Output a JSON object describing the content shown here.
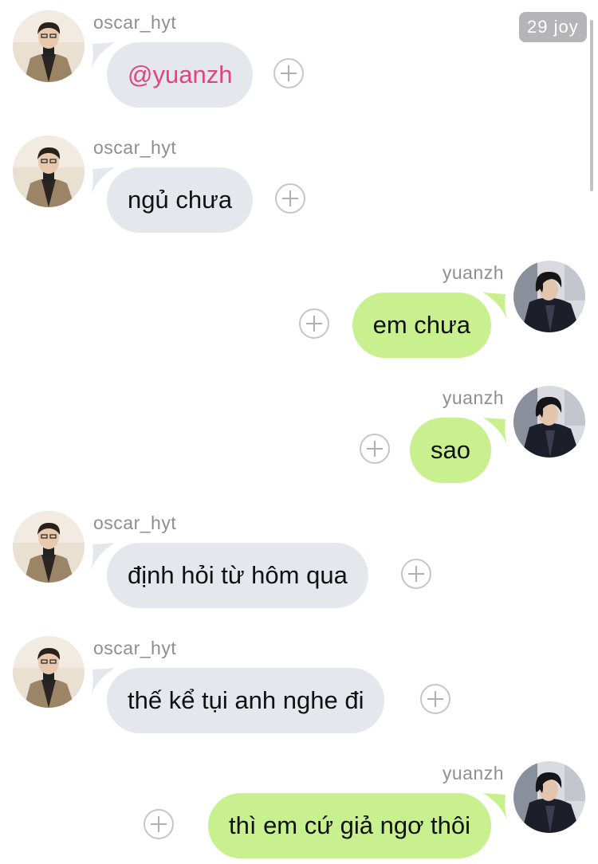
{
  "badge": "29 joy",
  "colors": {
    "incoming_bubble": "#e4e7ec",
    "outgoing_bubble": "#c9f08f",
    "mention": "#e0457b",
    "sender_name": "#8e8e93"
  },
  "messages": [
    {
      "sender": "oscar_hyt",
      "text": "@yuanzh",
      "direction": "incoming",
      "avatar": "oscar-avatar",
      "mention": true
    },
    {
      "sender": "oscar_hyt",
      "text": "ngủ chưa",
      "direction": "incoming",
      "avatar": "oscar-avatar"
    },
    {
      "sender": "yuanzh",
      "text": "em chưa",
      "direction": "outgoing",
      "avatar": "yuanzh-avatar"
    },
    {
      "sender": "yuanzh",
      "text": "sao",
      "direction": "outgoing",
      "avatar": "yuanzh-avatar"
    },
    {
      "sender": "oscar_hyt",
      "text": "định hỏi từ hôm qua",
      "direction": "incoming",
      "avatar": "oscar-avatar"
    },
    {
      "sender": "oscar_hyt",
      "text": "thế kể tụi anh nghe đi",
      "direction": "incoming",
      "avatar": "oscar-avatar"
    },
    {
      "sender": "yuanzh",
      "text": "thì em cứ giả ngơ thôi",
      "direction": "outgoing",
      "avatar": "yuanzh-avatar"
    }
  ]
}
